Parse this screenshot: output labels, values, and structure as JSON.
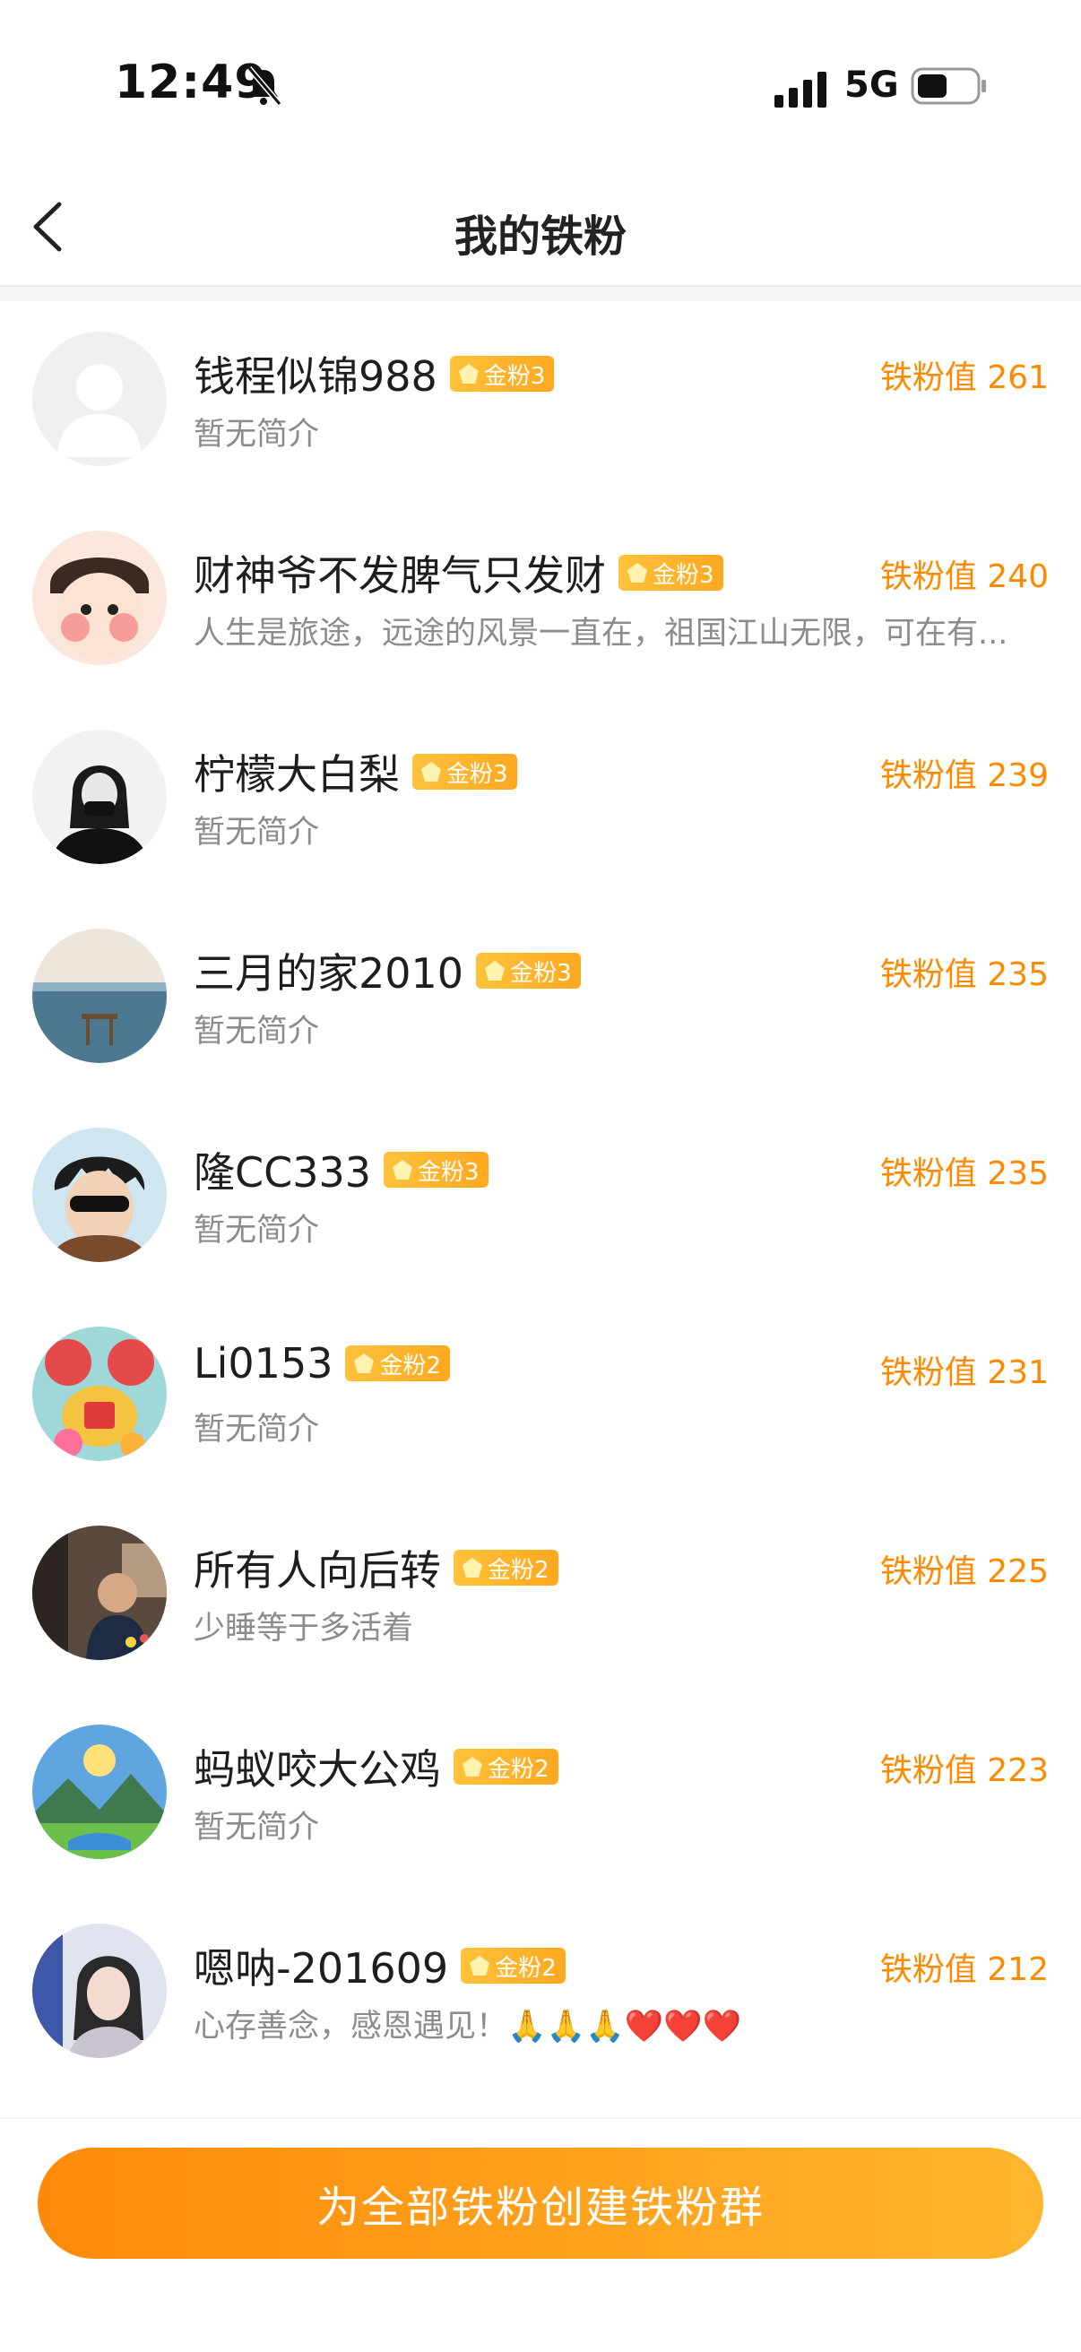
{
  "status_bar": {
    "time": "12:49",
    "network": "5G"
  },
  "nav": {
    "title": "我的铁粉"
  },
  "fans": [
    {
      "name": "钱程似锦988",
      "badge": "金粉3",
      "bio": "暂无简介",
      "score": "铁粉值 261",
      "avatar": "default-avatar"
    },
    {
      "name": "财神爷不发脾气只发财",
      "badge": "金粉3",
      "bio": "人生是旅途，远途的风景一直在，祖国江山无限，可在有...",
      "score": "铁粉值 240",
      "avatar": "cartoon-baby-avatar"
    },
    {
      "name": "柠檬大白梨",
      "badge": "金粉3",
      "bio": "暂无简介",
      "score": "铁粉值 239",
      "avatar": "bw-portrait-avatar"
    },
    {
      "name": "三月的家2010",
      "badge": "金粉3",
      "bio": "暂无简介",
      "score": "铁粉值 235",
      "avatar": "sea-avatar"
    },
    {
      "name": "隆CC333",
      "badge": "金粉3",
      "bio": "暂无简介",
      "score": "铁粉值 235",
      "avatar": "anime-sunglasses-avatar"
    },
    {
      "name": "Li0153",
      "badge": "金粉2",
      "bio": "暂无简介",
      "score": "铁粉值 231",
      "avatar": "fortune-horse-avatar"
    },
    {
      "name": "所有人向后转",
      "badge": "金粉2",
      "bio": "少睡等于多活着",
      "score": "铁粉值 225",
      "avatar": "photo-man-avatar"
    },
    {
      "name": "蚂蚁咬大公鸡",
      "badge": "金粉2",
      "bio": "暂无简介",
      "score": "铁粉值 223",
      "avatar": "landscape-avatar"
    },
    {
      "name": "嗯呐-201609",
      "badge": "金粉2",
      "bio": "心存善念，感恩遇见！🙏🙏🙏❤️❤️❤️",
      "score": "铁粉值 212",
      "avatar": "woman-portrait-avatar"
    }
  ],
  "footer": {
    "button_label": "为全部铁粉创建铁粉群"
  },
  "colors": {
    "accent": "#ff8a00",
    "badge": "#ffb22a",
    "button_start": "#ff8a0a",
    "button_end": "#ffb62e"
  }
}
